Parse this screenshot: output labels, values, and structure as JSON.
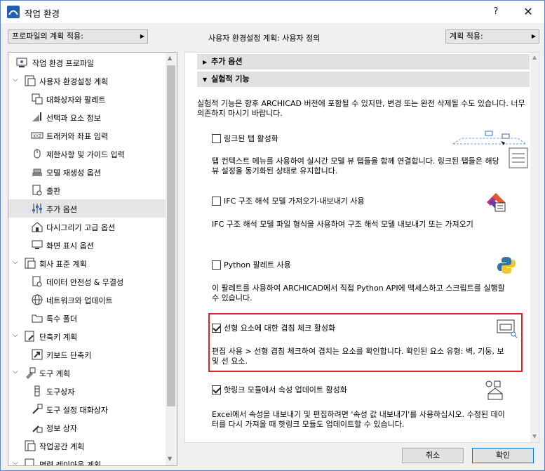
{
  "window": {
    "title": "작업 환경",
    "help_label": "?",
    "close_label": "✕"
  },
  "top_bar": {
    "apply_profile_label": "프로파일의 계획 적용:",
    "scheme_label": "사용자 환경설정 계획: 사용자 정의",
    "apply_scheme_label": "계획 적용:"
  },
  "tree": {
    "items": [
      {
        "label": "작업 환경 프로파일"
      },
      {
        "label": "사용자 환경설정 계획"
      },
      {
        "label": "대화상자와 팔레트"
      },
      {
        "label": "선택과 요소 정보"
      },
      {
        "label": "트래커와 좌표 입력"
      },
      {
        "label": "제한사항 및 가이드 입력"
      },
      {
        "label": "모델 재생성 옵션"
      },
      {
        "label": "출판"
      },
      {
        "label": "추가 옵션"
      },
      {
        "label": "다시그리기 고급 옵션"
      },
      {
        "label": "화면 표시 옵션"
      },
      {
        "label": "회사 표준 계획"
      },
      {
        "label": "데이터 안전성 & 무결성"
      },
      {
        "label": "네트워크와 업데이트"
      },
      {
        "label": "특수 폴더"
      },
      {
        "label": "단축키 계획"
      },
      {
        "label": "키보드 단축키"
      },
      {
        "label": "도구 계획"
      },
      {
        "label": "도구상자"
      },
      {
        "label": "도구 설정 대화상자"
      },
      {
        "label": "정보 상자"
      },
      {
        "label": "작업공간 계획"
      },
      {
        "label": "명령 레이아웃 계획"
      }
    ]
  },
  "content": {
    "section_more_options": "추가 옵션",
    "section_experimental": "실험적 기능",
    "intro": "실험적 기능은 향후 ARCHICAD 버전에 포함될 수 있지만, 변경 또는 완전 삭제될 수도 있습니다. 너무 의존하지 마시기 바랍니다.",
    "features": [
      {
        "label": "링크된 탭 활성화",
        "checked": false,
        "desc": "탭 컨텍스트 메뉴를 사용하여 실시간 모델 뷰 탭들을 함께 연결합니다. 링크된 탭들은 해당 뷰 설정을 동기화된 상태로 유지합니다."
      },
      {
        "label": "IFC 구조 해석 모델 가져오기-내보내기 사용",
        "checked": false,
        "desc": "IFC 구조 해석 모델 파일 형식을 사용하여 구조 해석 모델 내보내기 또는 가져오기"
      },
      {
        "label": "Python 팔레트 사용",
        "checked": false,
        "desc": "이 팔레트를 사용하여 ARCHICAD에서 직접 Python API에 액세스하고 스크립트를 실행할 수 있습니다."
      },
      {
        "label": "선형 요소에 대한 겹침 체크 활성화",
        "checked": true,
        "desc": "편집 사용 > 선형 겹침 체크하여 겹치는 요소를 확인합니다. 확인된 요소 유형: 벽, 기둥, 보 및 선 요소."
      },
      {
        "label": "핫링크 모듈에서 속성 업데이트 활성화",
        "checked": true,
        "desc": "Excel에서 속성을 내보내기 및 편집하려면 '속성 값 내보내기'를 사용하십시오. 수정된 데이터를 다시 가져올 때 핫링크 모듈도 업데이트할 수 있습니다."
      }
    ]
  },
  "buttons": {
    "cancel": "취소",
    "ok": "확인"
  },
  "colors": {
    "highlight": "#e0202c",
    "selection": "#e5e5e5",
    "window_border": "#5b86c6"
  }
}
